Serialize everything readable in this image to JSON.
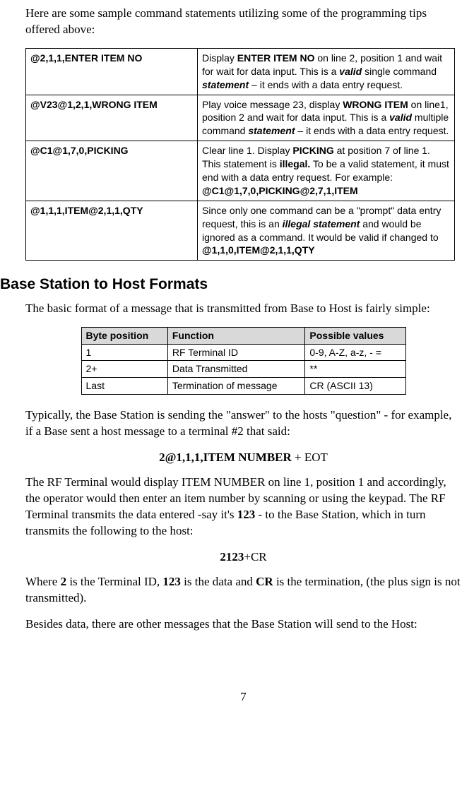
{
  "intro": "Here are some sample command statements utilizing some of the programming tips offered above:",
  "samples": [
    {
      "cmd": "@2,1,1,ENTER ITEM NO",
      "desc_parts": [
        {
          "t": "Display "
        },
        {
          "t": "ENTER ITEM NO",
          "b": true
        },
        {
          "t": " on line 2, position 1 and wait for wait for data input. This is a "
        },
        {
          "t": "valid",
          "bi": true
        },
        {
          "t": " single command "
        },
        {
          "t": "statement",
          "bi": true
        },
        {
          "t": " – it ends with a data entry request."
        }
      ]
    },
    {
      "cmd": "@V23@1,2,1,WRONG ITEM",
      "desc_parts": [
        {
          "t": "Play voice message 23, display "
        },
        {
          "t": "WRONG ITEM",
          "b": true
        },
        {
          "t": " on line1, position 2 and wait for data input. This is a "
        },
        {
          "t": "valid",
          "bi": true
        },
        {
          "t": " multiple command "
        },
        {
          "t": "statement",
          "bi": true
        },
        {
          "t": " – it ends with a data entry request."
        }
      ]
    },
    {
      "cmd": "@C1@1,7,0,PICKING",
      "desc_parts": [
        {
          "t": "Clear line 1. Display "
        },
        {
          "t": "PICKING",
          "b": true
        },
        {
          "t": " at position 7 of line 1. This statement is "
        },
        {
          "t": "illegal.",
          "b": true
        },
        {
          "t": " To be a valid statement, it must end with a data entry request. For example: "
        },
        {
          "t": "@C1@1,7,0,PICKING@2,7,1,ITEM",
          "b": true
        }
      ]
    },
    {
      "cmd": "@1,1,1,ITEM@2,1,1,QTY",
      "desc_parts": [
        {
          "t": "Since only one command can be a \"prompt\" data entry request, this is an "
        },
        {
          "t": "illegal statement",
          "bi": true
        },
        {
          "t": " and would be ignored as a command. It would be valid if changed to "
        },
        {
          "t": "@1,1,0,ITEM@2,1,1,QTY",
          "b": true
        }
      ]
    }
  ],
  "section_heading": "Base Station to Host Formats",
  "section_intro": "The basic format of a message that is transmitted from Base to Host is fairly simple:",
  "format_headers": [
    "Byte position",
    "Function",
    "Possible values"
  ],
  "format_rows": [
    [
      "1",
      "RF Terminal ID",
      "0-9, A-Z, a-z, - ="
    ],
    [
      "2+",
      "Data Transmitted",
      "**"
    ],
    [
      "Last",
      "Termination of message",
      "CR (ASCII 13)"
    ]
  ],
  "para_typically": "Typically, the Base Station is sending the \"answer\" to the hosts \"question\" - for example, if a Base sent a host message to a terminal #2 that said:",
  "example1_parts": [
    {
      "t": "2@1,1,1,ITEM NUMBER",
      "b": true
    },
    {
      "t": " + EOT"
    }
  ],
  "para_rf_parts": [
    {
      "t": "The RF Terminal would display ITEM NUMBER on line 1, position 1 and accordingly, the operator would then enter an item number by scanning or using the keypad. The RF Terminal transmits the data entered -say it's "
    },
    {
      "t": "123",
      "b": true
    },
    {
      "t": " - to the Base Station, which in turn transmits the following to the host:"
    }
  ],
  "example2_parts": [
    {
      "t": "2123",
      "b": true
    },
    {
      "t": "+CR"
    }
  ],
  "para_where_parts": [
    {
      "t": "Where "
    },
    {
      "t": "2",
      "b": true
    },
    {
      "t": " is the Terminal ID, "
    },
    {
      "t": "123",
      "b": true
    },
    {
      "t": " is the data and "
    },
    {
      "t": "CR",
      "b": true
    },
    {
      "t": " is the termination, (the plus sign is not transmitted)."
    }
  ],
  "para_besides": "Besides data, there are other messages that the Base Station will send to the Host:",
  "page_number": "7"
}
